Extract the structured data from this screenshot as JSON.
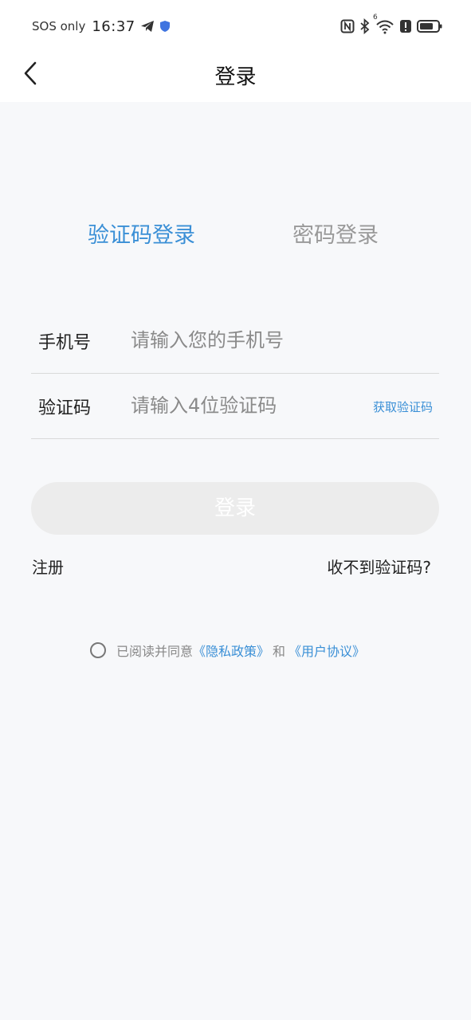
{
  "status_bar": {
    "sos": "SOS only",
    "time": "16:37",
    "network_badge": "6",
    "icons": [
      "telegram-icon",
      "shield-icon",
      "nfc-icon",
      "bluetooth-icon",
      "wifi-icon",
      "alert-icon",
      "battery-icon"
    ]
  },
  "header": {
    "title": "登录",
    "back_icon": "chevron-left-icon"
  },
  "tabs": [
    {
      "label": "验证码登录",
      "active": true
    },
    {
      "label": "密码登录",
      "active": false
    }
  ],
  "form": {
    "phone": {
      "label": "手机号",
      "placeholder": "请输入您的手机号",
      "value": ""
    },
    "code": {
      "label": "验证码",
      "placeholder": "请输入4位验证码",
      "value": "",
      "get_code_label": "获取验证码"
    }
  },
  "login_button": "登录",
  "links": {
    "register": "注册",
    "no_code": "收不到验证码?"
  },
  "agreement": {
    "prefix": "已阅读并同意",
    "privacy": "《隐私政策》",
    "and": "和",
    "user_agreement": "《用户协议》",
    "checked": false
  },
  "colors": {
    "accent": "#3a8fd6",
    "inactive_tab": "#999999",
    "button_disabled_bg": "#ececec",
    "page_bg": "#f7f8fa"
  }
}
